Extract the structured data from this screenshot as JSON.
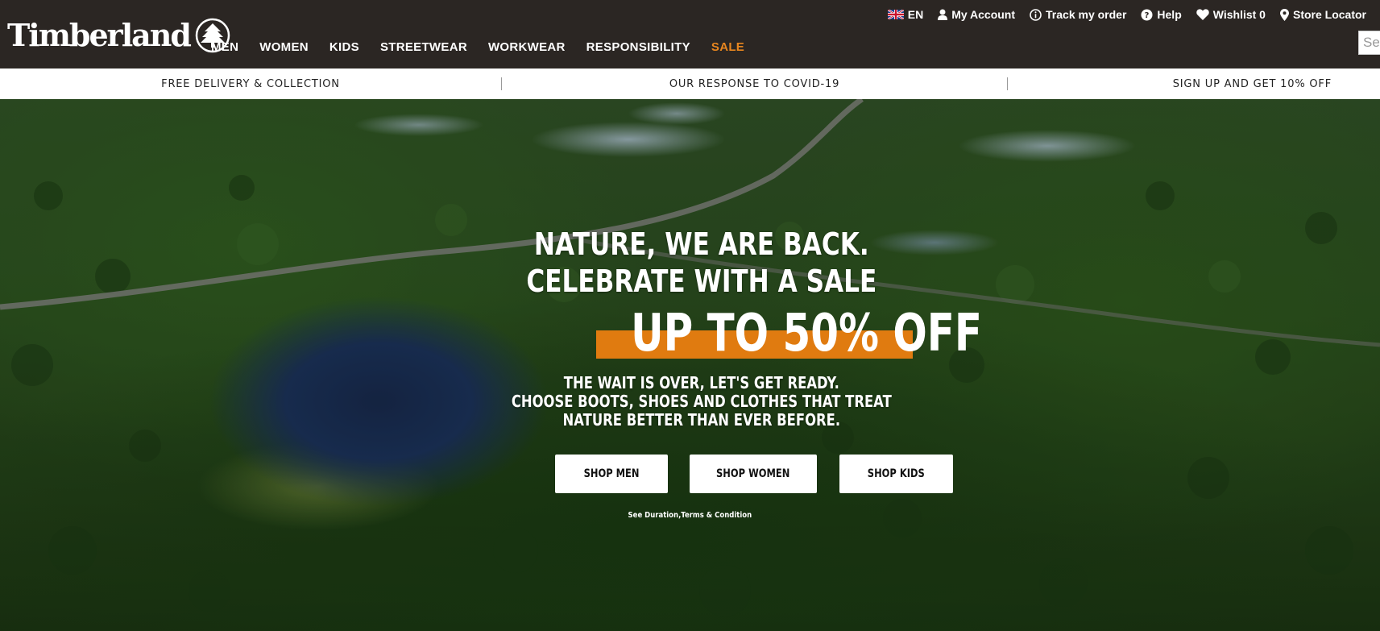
{
  "brand": {
    "name": "Timberland"
  },
  "utility": {
    "language": "EN",
    "my_account": "My Account",
    "track_order": "Track my order",
    "help": "Help",
    "wishlist": "Wishlist 0",
    "store_locator": "Store Locator"
  },
  "nav": {
    "items": [
      "MEN",
      "WOMEN",
      "KIDS",
      "STREETWEAR",
      "WORKWEAR",
      "RESPONSIBILITY",
      "SALE"
    ]
  },
  "search": {
    "placeholder": "Search"
  },
  "promo_bar": {
    "items": [
      "FREE DELIVERY & COLLECTION",
      "OUR RESPONSE TO COVID-19",
      "SIGN UP AND GET 10% OFF"
    ]
  },
  "hero": {
    "headline_1": "NATURE, WE ARE BACK.",
    "headline_2": "CELEBRATE WITH A SALE",
    "offer": "UP TO 50% OFF",
    "sub_1": "THE WAIT IS OVER, LET'S GET READY.",
    "sub_2": "CHOOSE BOOTS, SHOES AND CLOTHES THAT TREAT",
    "sub_3": "NATURE BETTER THAN EVER BEFORE.",
    "cta_men": "SHOP MEN",
    "cta_women": "SHOP WOMEN",
    "cta_kids": "SHOP KIDS",
    "terms": "See Duration,Terms & Condition"
  },
  "colors": {
    "header_bg": "#2b2623",
    "sale_accent": "#e8861f",
    "offer_bar": "#e07b10",
    "promo_bg": "#ffffff"
  },
  "icons": [
    "timberland-tree-icon",
    "uk-flag-icon",
    "user-icon",
    "info-circle-icon",
    "help-circle-icon",
    "heart-icon",
    "map-pin-icon"
  ]
}
